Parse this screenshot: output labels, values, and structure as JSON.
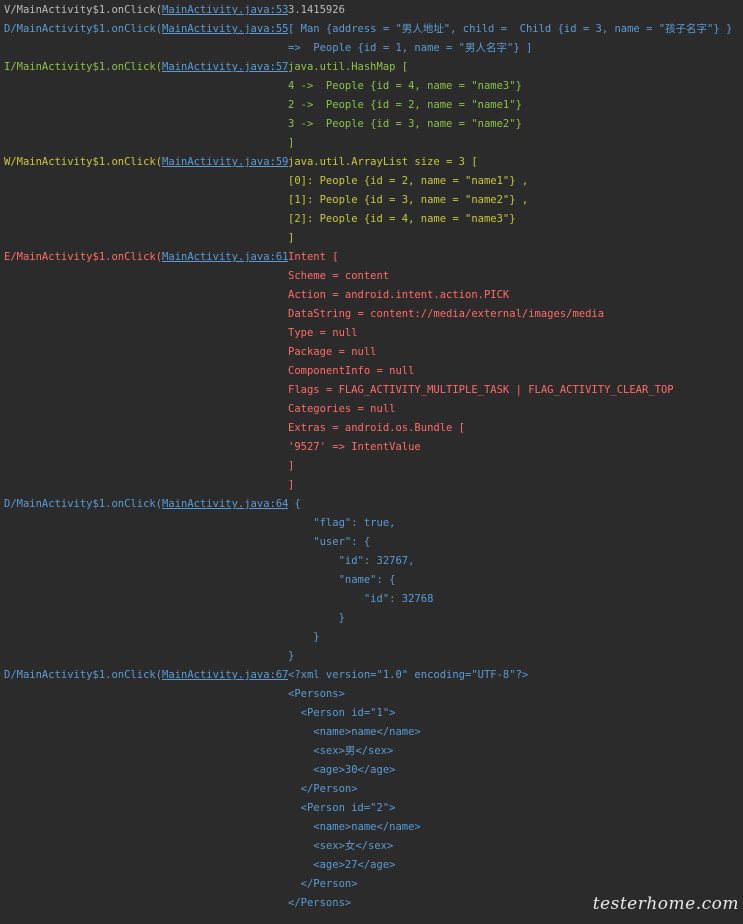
{
  "entries": [
    {
      "level_class": "c-v",
      "prefix": "V/MainActivity$1.onClick(",
      "link": "MainActivity.java:53",
      "suffix": "): ",
      "lines": [
        "3.1415926"
      ]
    },
    {
      "level_class": "c-d",
      "prefix": "D/MainActivity$1.onClick(",
      "link": "MainActivity.java:55",
      "suffix": "): ",
      "lines": [
        "[ Man {address = \"男人地址\", child =  Child {id = 3, name = \"孩子名字\"} }",
        "=>  People {id = 1, name = \"男人名字\"} ]"
      ]
    },
    {
      "level_class": "c-i",
      "prefix": "I/MainActivity$1.onClick(",
      "link": "MainActivity.java:57",
      "suffix": "): ",
      "lines": [
        "java.util.HashMap [",
        "4 ->  People {id = 4, name = \"name3\"}",
        "2 ->  People {id = 2, name = \"name1\"}",
        "3 ->  People {id = 3, name = \"name2\"}",
        "]"
      ]
    },
    {
      "level_class": "c-w",
      "prefix": "W/MainActivity$1.onClick(",
      "link": "MainActivity.java:59",
      "suffix": "): ",
      "lines": [
        "java.util.ArrayList size = 3 [",
        "[0]: People {id = 2, name = \"name1\"} ,",
        "[1]: People {id = 3, name = \"name2\"} ,",
        "[2]: People {id = 4, name = \"name3\"}",
        "]"
      ]
    },
    {
      "level_class": "c-e",
      "prefix": "E/MainActivity$1.onClick(",
      "link": "MainActivity.java:61",
      "suffix": "): ",
      "lines": [
        "Intent [",
        "Scheme = content",
        "Action = android.intent.action.PICK",
        "DataString = content://media/external/images/media",
        "Type = null",
        "Package = null",
        "ComponentInfo = null",
        "Flags = FLAG_ACTIVITY_MULTIPLE_TASK | FLAG_ACTIVITY_CLEAR_TOP",
        "Categories = null",
        "Extras = android.os.Bundle [",
        "'9527' => IntentValue",
        "]",
        "]"
      ]
    },
    {
      "level_class": "c-d",
      "prefix": "D/MainActivity$1.onClick(",
      "link": "MainActivity.java:64",
      "suffix": "): ",
      "lines": [
        " {",
        "    \"flag\": true,",
        "    \"user\": {",
        "        \"id\": 32767,",
        "        \"name\": {",
        "            \"id\": 32768",
        "        }",
        "    }",
        "}"
      ]
    },
    {
      "level_class": "c-d",
      "prefix": "D/MainActivity$1.onClick(",
      "link": "MainActivity.java:67",
      "suffix": "): ",
      "lines": [
        "<?xml version=\"1.0\" encoding=\"UTF-8\"?>",
        "<Persons>",
        "  <Person id=\"1\">",
        "    <name>name</name>",
        "    <sex>男</sex>",
        "    <age>30</age>",
        "  </Person>",
        "  <Person id=\"2\">",
        "    <name>name</name>",
        "    <sex>女</sex>",
        "    <age>27</age>",
        "  </Person>",
        "</Persons>"
      ]
    }
  ],
  "watermark": "testerhome.com"
}
